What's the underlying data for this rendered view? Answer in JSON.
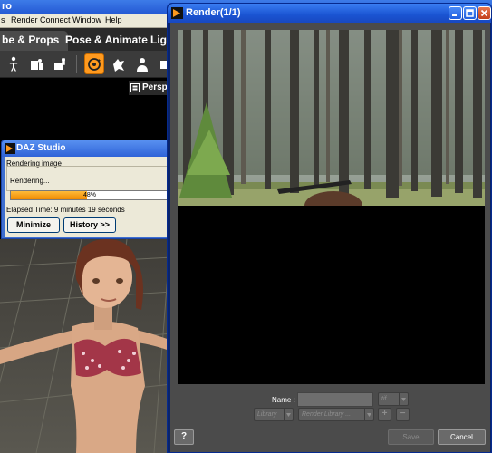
{
  "app": {
    "title": "ro",
    "menu": [
      "s",
      "Render",
      "Connect",
      "Window",
      "Help"
    ],
    "tabs": [
      "be & Props",
      "Pose & Animate",
      "Ligh"
    ],
    "viewport_label": "Perspe",
    "icons": [
      "pose-figure-icon",
      "scene-props-icon",
      "figure-setup-icon",
      "rotate-tool-icon",
      "universal-tool-icon",
      "node-tool-icon",
      "camera-icon"
    ],
    "accent": "#ff9a1f"
  },
  "progress": {
    "title": "DAZ Studio",
    "heading": "Rendering image",
    "status": "Rendering...",
    "percent": 48,
    "percent_label": "48%",
    "elapsed": "Elapsed Time: 9 minutes 19 seconds",
    "minimize_label": "Minimize",
    "history_label": "History >>"
  },
  "render": {
    "title": "Render(1/1)",
    "progress_fraction": 0.495,
    "name_label": "Name :",
    "name_value": "",
    "format_value": "tif",
    "library_value": "Library",
    "render_library_value": "Render Library ...",
    "add_label": "+",
    "remove_label": "−",
    "help_label": "?",
    "save_label": "Save",
    "cancel_label": "Cancel"
  }
}
